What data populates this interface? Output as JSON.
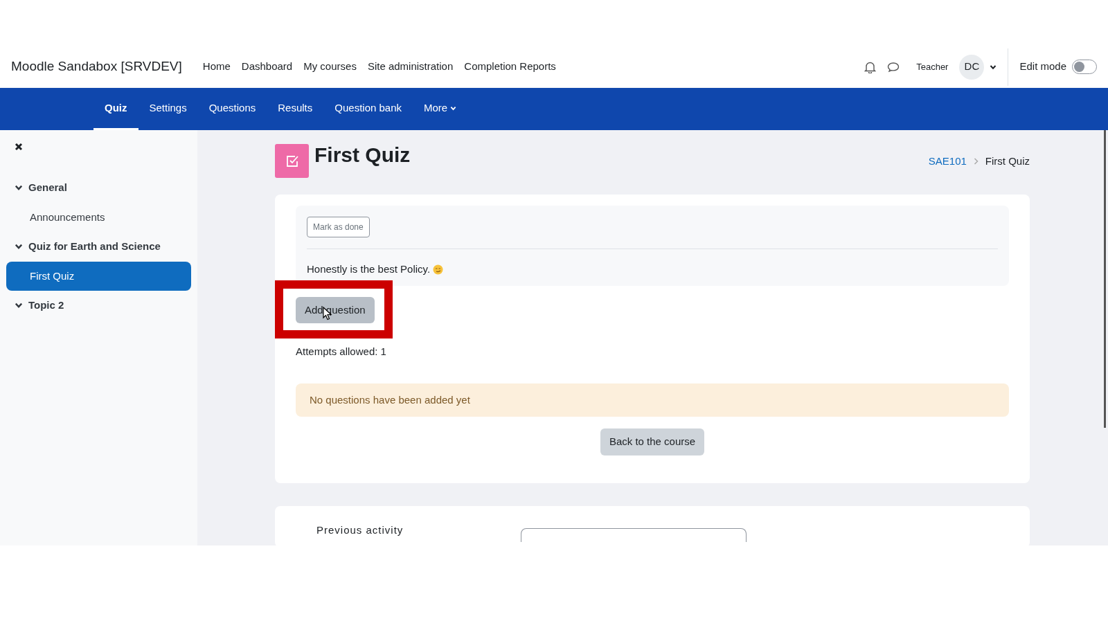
{
  "site_name": "Moodle Sandabox [SRVDEV]",
  "primary_nav": [
    {
      "label": "Home"
    },
    {
      "label": "Dashboard"
    },
    {
      "label": "My courses"
    },
    {
      "label": "Site administration"
    },
    {
      "label": "Completion Reports"
    }
  ],
  "user": {
    "role": "Teacher",
    "initials": "DC"
  },
  "edit_mode": {
    "label": "Edit mode",
    "on": false
  },
  "secondary_nav": [
    {
      "label": "Quiz",
      "selected": true,
      "kind": "link"
    },
    {
      "label": "Settings",
      "selected": false,
      "kind": "link"
    },
    {
      "label": "Questions",
      "selected": false,
      "kind": "link"
    },
    {
      "label": "Results",
      "selected": false,
      "kind": "link"
    },
    {
      "label": "Question bank",
      "selected": false,
      "kind": "link"
    },
    {
      "label": "More",
      "selected": false,
      "kind": "dropdown"
    }
  ],
  "sidebar": {
    "sections": [
      {
        "title": "General",
        "expanded": true,
        "children": [
          {
            "label": "Announcements",
            "selected": false
          }
        ]
      },
      {
        "title": "Quiz for Earth and Science",
        "expanded": true,
        "children": [
          {
            "label": "First Quiz",
            "selected": true
          }
        ]
      },
      {
        "title": "Topic 2",
        "expanded": true
      }
    ]
  },
  "page": {
    "title": "First Quiz",
    "breadcrumb": [
      {
        "label": "SAE101",
        "kind": "link"
      },
      {
        "label": "First Quiz",
        "kind": "current"
      }
    ]
  },
  "activity": {
    "completion_button": "Mark as done",
    "description": "Honestly is the best Policy."
  },
  "add_question_button": "Add question",
  "attempts": "Attempts allowed: 1",
  "notice": "No questions have been added yet",
  "back_button": "Back to the course",
  "navigation": {
    "previous_label": "Previous activity"
  }
}
